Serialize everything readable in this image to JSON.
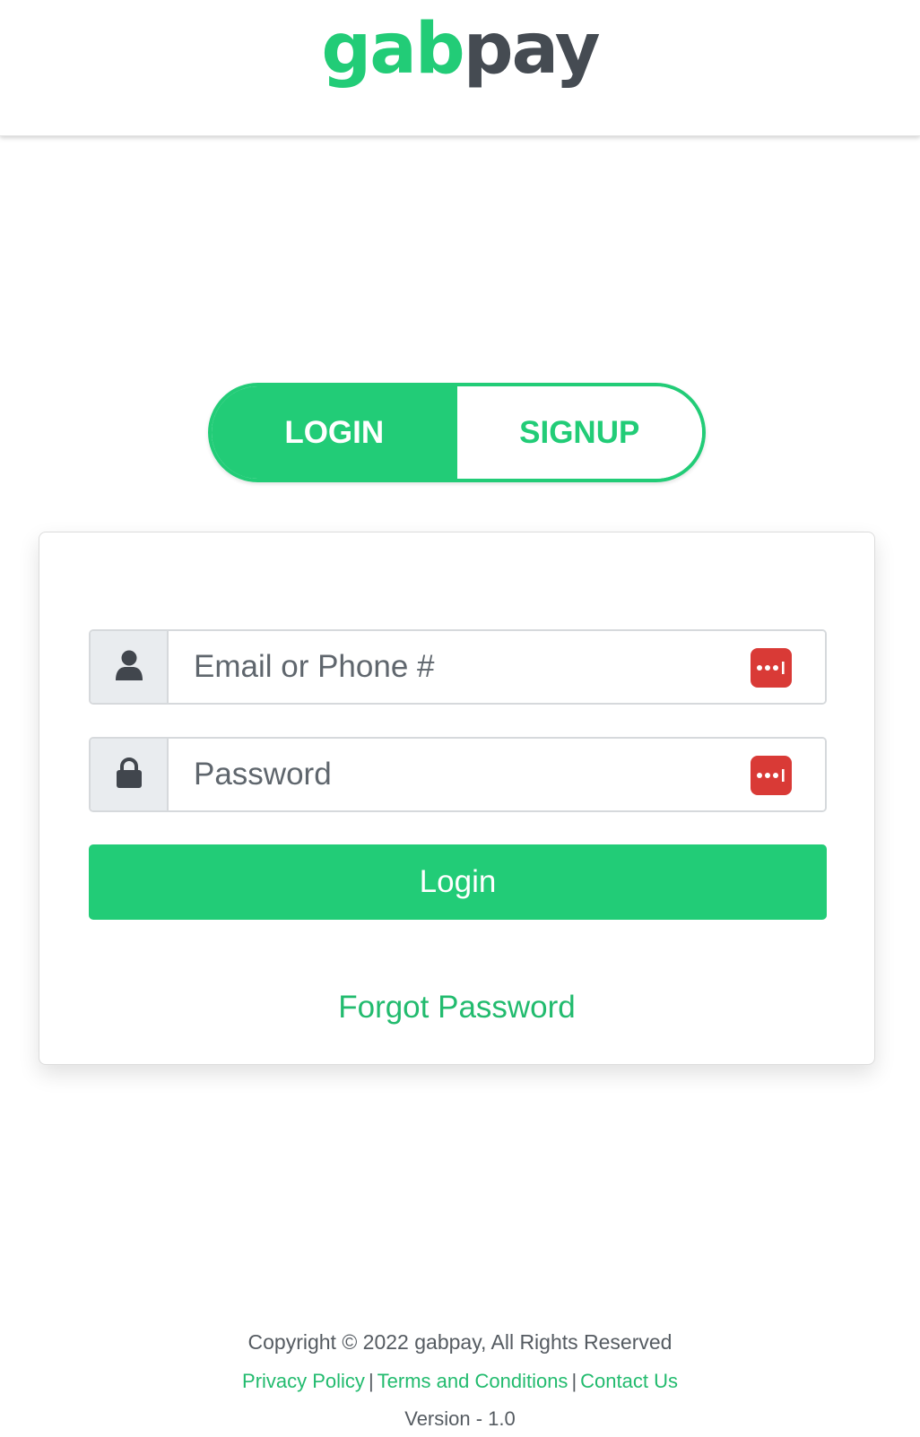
{
  "brand": {
    "logo_part1": "gab",
    "logo_part2": "pay",
    "primary_color": "#22cc77",
    "dark_color": "#454b52"
  },
  "auth_toggle": {
    "login_label": "LOGIN",
    "signup_label": "SIGNUP",
    "active": "login"
  },
  "form": {
    "email_placeholder": "Email or Phone #",
    "email_value": "",
    "password_placeholder": "Password",
    "password_value": "",
    "submit_label": "Login",
    "forgot_label": "Forgot Password",
    "password_manager_icon": "password-manager-icon",
    "email_icon": "user-icon",
    "password_icon": "lock-icon"
  },
  "footer": {
    "copyright": "Copyright © 2022 gabpay, All Rights Reserved",
    "links": [
      "Privacy Policy",
      "Terms and Conditions",
      "Contact Us"
    ],
    "separator": "|",
    "version": "Version - 1.0"
  }
}
